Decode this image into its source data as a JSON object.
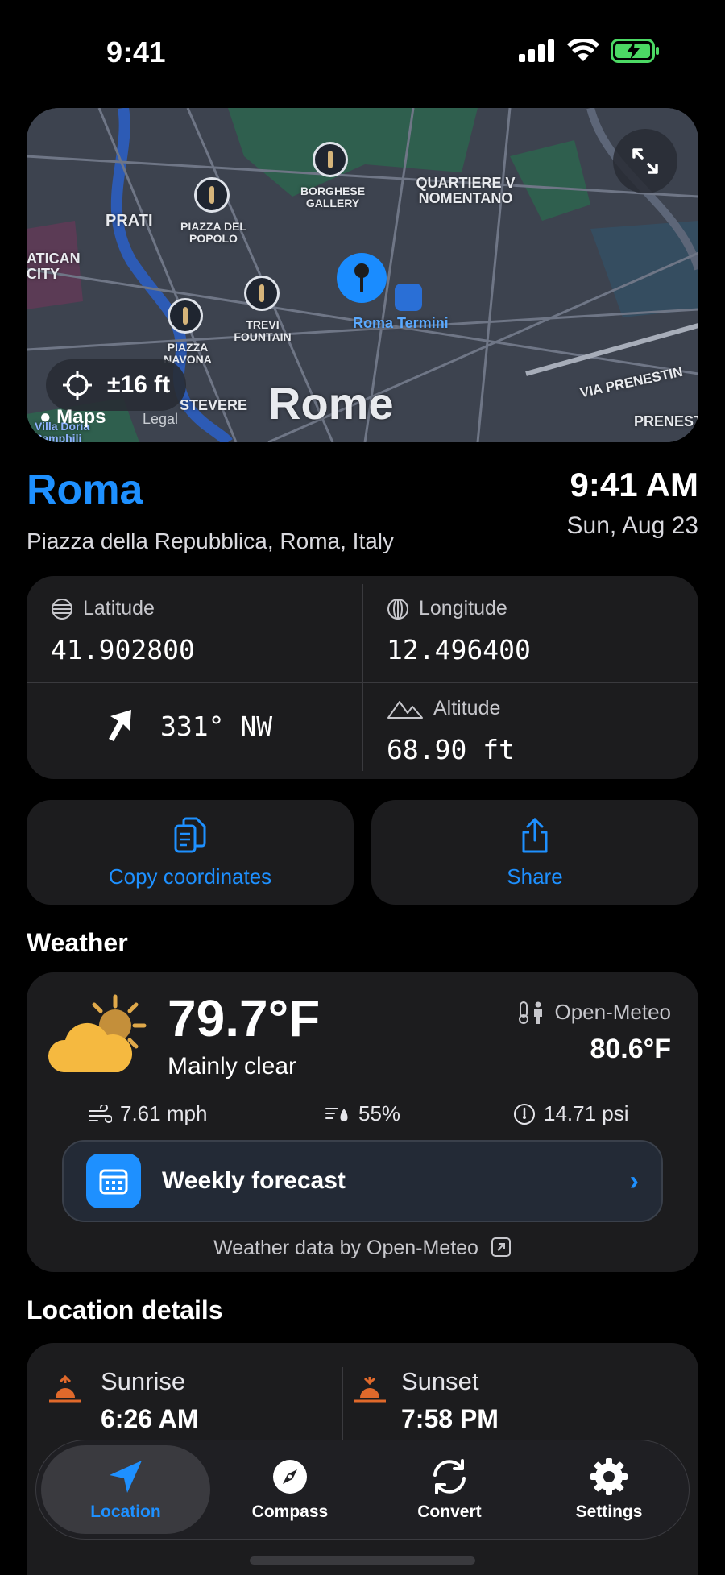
{
  "status": {
    "time": "9:41"
  },
  "map": {
    "accuracy": "±16 ft",
    "city_label": "Rome",
    "maps_label": "Maps",
    "legal": "Legal",
    "labels": {
      "prati": "PRATI",
      "piazza_del_popolo": "PIAZZA DEL POPOLO",
      "borghese": "BORGHESE GALLERY",
      "quartiere": "QUARTIERE V NOMENTANO",
      "vatican": "ATICAN CITY",
      "trevi": "TREVI FOUNTAIN",
      "navona": "PIAZZA NAVONA",
      "termini": "Roma Termini",
      "trastevere": "STEVERE",
      "via_prenestina": "VIA PRENESTIN",
      "prenest": "PRENEST",
      "villa": "Villa Doria Pamphili"
    }
  },
  "location": {
    "city": "Roma",
    "address": "Piazza della Repubblica, Roma, Italy",
    "time": "9:41 AM",
    "date": "Sun, Aug 23"
  },
  "coords": {
    "latitude_label": "Latitude",
    "latitude": "41.902800",
    "longitude_label": "Longitude",
    "longitude": "12.496400",
    "heading": "331° NW",
    "altitude_label": "Altitude",
    "altitude": "68.90 ft"
  },
  "actions": {
    "copy": "Copy coordinates",
    "share": "Share"
  },
  "weather": {
    "title": "Weather",
    "temp": "79.7°F",
    "condition": "Mainly clear",
    "provider": "Open-Meteo",
    "feels_like": "80.6°F",
    "wind": "7.61 mph",
    "humidity": "55%",
    "pressure": "14.71 psi",
    "forecast": "Weekly forecast",
    "attribution": "Weather data by Open-Meteo"
  },
  "details": {
    "title": "Location details",
    "sunrise_label": "Sunrise",
    "sunrise": "6:26 AM",
    "sunset_label": "Sunset",
    "sunset": "7:58 PM"
  },
  "tabs": [
    {
      "label": "Location"
    },
    {
      "label": "Compass"
    },
    {
      "label": "Convert"
    },
    {
      "label": "Settings"
    }
  ],
  "colors": {
    "accent": "#1e90ff",
    "card": "#1c1c1e",
    "battery": "#4cd964"
  }
}
